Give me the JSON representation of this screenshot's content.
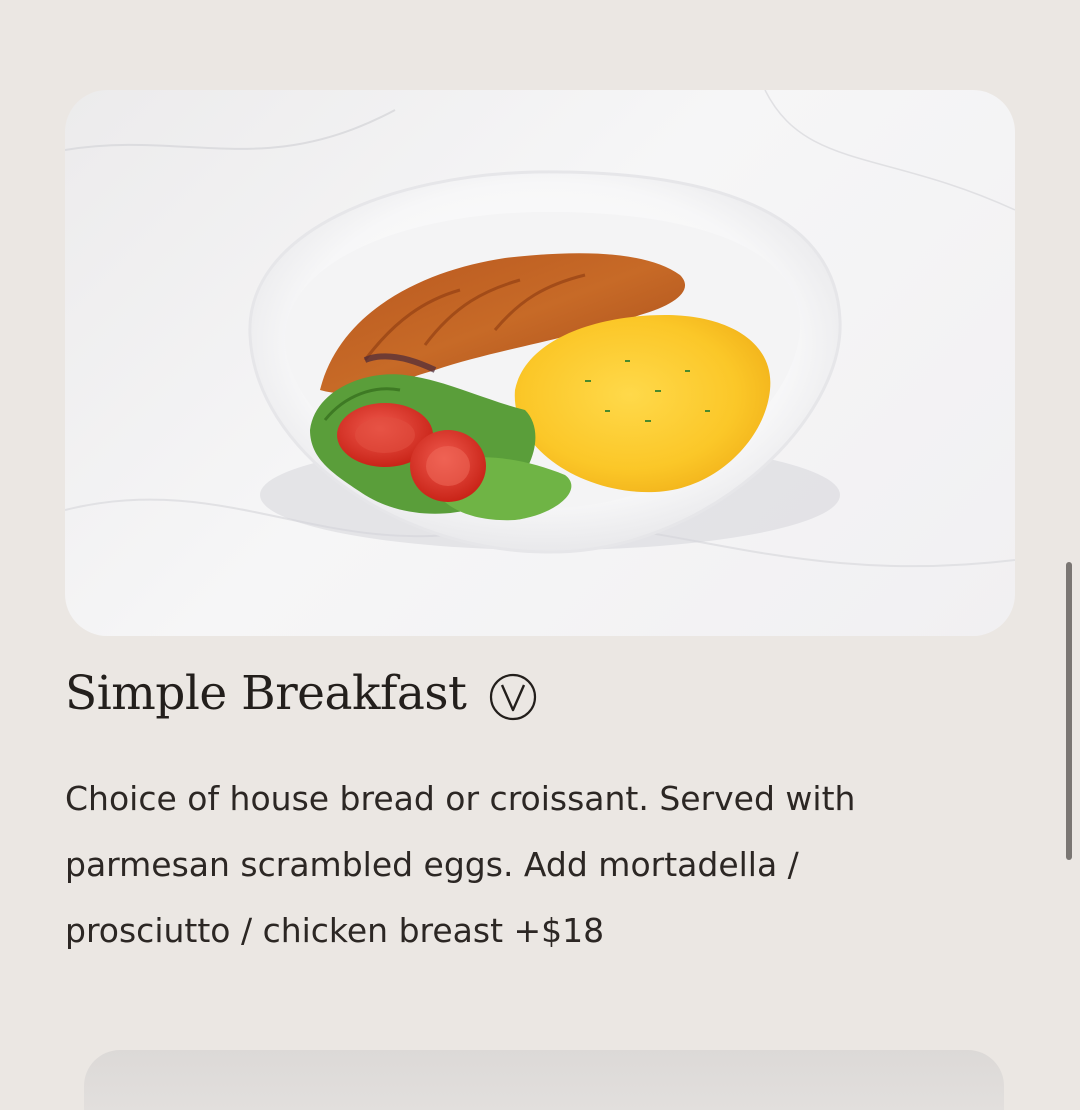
{
  "menu_item": {
    "title": "Simple Breakfast",
    "badge_icon": "vegetarian-v-icon",
    "description": "Choice of house bread or croissant. Served with parmesan scrambled eggs. Add mortadella / prosciutto / chicken breast +$18",
    "image_icon": "simple-breakfast-photo"
  },
  "colors": {
    "background": "#ebe7e3",
    "text": "#2a2522",
    "scrollbar": "#7a7673"
  }
}
